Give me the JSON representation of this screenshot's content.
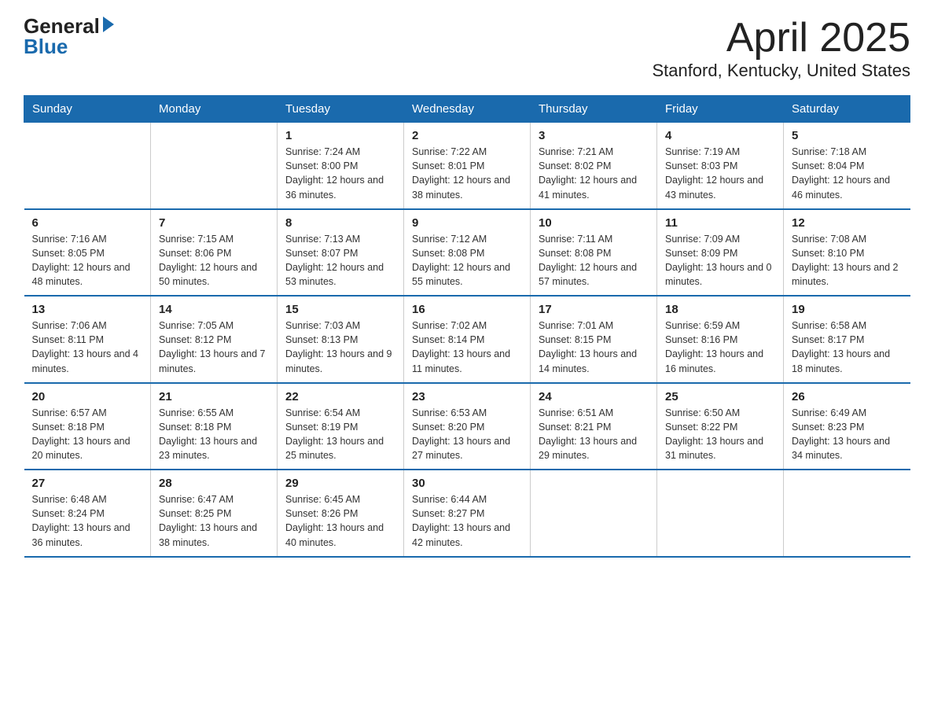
{
  "header": {
    "logo_general": "General",
    "logo_blue": "Blue",
    "title": "April 2025",
    "subtitle": "Stanford, Kentucky, United States"
  },
  "days_of_week": [
    "Sunday",
    "Monday",
    "Tuesday",
    "Wednesday",
    "Thursday",
    "Friday",
    "Saturday"
  ],
  "weeks": [
    [
      {
        "day": "",
        "info": ""
      },
      {
        "day": "",
        "info": ""
      },
      {
        "day": "1",
        "info": "Sunrise: 7:24 AM\nSunset: 8:00 PM\nDaylight: 12 hours\nand 36 minutes."
      },
      {
        "day": "2",
        "info": "Sunrise: 7:22 AM\nSunset: 8:01 PM\nDaylight: 12 hours\nand 38 minutes."
      },
      {
        "day": "3",
        "info": "Sunrise: 7:21 AM\nSunset: 8:02 PM\nDaylight: 12 hours\nand 41 minutes."
      },
      {
        "day": "4",
        "info": "Sunrise: 7:19 AM\nSunset: 8:03 PM\nDaylight: 12 hours\nand 43 minutes."
      },
      {
        "day": "5",
        "info": "Sunrise: 7:18 AM\nSunset: 8:04 PM\nDaylight: 12 hours\nand 46 minutes."
      }
    ],
    [
      {
        "day": "6",
        "info": "Sunrise: 7:16 AM\nSunset: 8:05 PM\nDaylight: 12 hours\nand 48 minutes."
      },
      {
        "day": "7",
        "info": "Sunrise: 7:15 AM\nSunset: 8:06 PM\nDaylight: 12 hours\nand 50 minutes."
      },
      {
        "day": "8",
        "info": "Sunrise: 7:13 AM\nSunset: 8:07 PM\nDaylight: 12 hours\nand 53 minutes."
      },
      {
        "day": "9",
        "info": "Sunrise: 7:12 AM\nSunset: 8:08 PM\nDaylight: 12 hours\nand 55 minutes."
      },
      {
        "day": "10",
        "info": "Sunrise: 7:11 AM\nSunset: 8:08 PM\nDaylight: 12 hours\nand 57 minutes."
      },
      {
        "day": "11",
        "info": "Sunrise: 7:09 AM\nSunset: 8:09 PM\nDaylight: 13 hours\nand 0 minutes."
      },
      {
        "day": "12",
        "info": "Sunrise: 7:08 AM\nSunset: 8:10 PM\nDaylight: 13 hours\nand 2 minutes."
      }
    ],
    [
      {
        "day": "13",
        "info": "Sunrise: 7:06 AM\nSunset: 8:11 PM\nDaylight: 13 hours\nand 4 minutes."
      },
      {
        "day": "14",
        "info": "Sunrise: 7:05 AM\nSunset: 8:12 PM\nDaylight: 13 hours\nand 7 minutes."
      },
      {
        "day": "15",
        "info": "Sunrise: 7:03 AM\nSunset: 8:13 PM\nDaylight: 13 hours\nand 9 minutes."
      },
      {
        "day": "16",
        "info": "Sunrise: 7:02 AM\nSunset: 8:14 PM\nDaylight: 13 hours\nand 11 minutes."
      },
      {
        "day": "17",
        "info": "Sunrise: 7:01 AM\nSunset: 8:15 PM\nDaylight: 13 hours\nand 14 minutes."
      },
      {
        "day": "18",
        "info": "Sunrise: 6:59 AM\nSunset: 8:16 PM\nDaylight: 13 hours\nand 16 minutes."
      },
      {
        "day": "19",
        "info": "Sunrise: 6:58 AM\nSunset: 8:17 PM\nDaylight: 13 hours\nand 18 minutes."
      }
    ],
    [
      {
        "day": "20",
        "info": "Sunrise: 6:57 AM\nSunset: 8:18 PM\nDaylight: 13 hours\nand 20 minutes."
      },
      {
        "day": "21",
        "info": "Sunrise: 6:55 AM\nSunset: 8:18 PM\nDaylight: 13 hours\nand 23 minutes."
      },
      {
        "day": "22",
        "info": "Sunrise: 6:54 AM\nSunset: 8:19 PM\nDaylight: 13 hours\nand 25 minutes."
      },
      {
        "day": "23",
        "info": "Sunrise: 6:53 AM\nSunset: 8:20 PM\nDaylight: 13 hours\nand 27 minutes."
      },
      {
        "day": "24",
        "info": "Sunrise: 6:51 AM\nSunset: 8:21 PM\nDaylight: 13 hours\nand 29 minutes."
      },
      {
        "day": "25",
        "info": "Sunrise: 6:50 AM\nSunset: 8:22 PM\nDaylight: 13 hours\nand 31 minutes."
      },
      {
        "day": "26",
        "info": "Sunrise: 6:49 AM\nSunset: 8:23 PM\nDaylight: 13 hours\nand 34 minutes."
      }
    ],
    [
      {
        "day": "27",
        "info": "Sunrise: 6:48 AM\nSunset: 8:24 PM\nDaylight: 13 hours\nand 36 minutes."
      },
      {
        "day": "28",
        "info": "Sunrise: 6:47 AM\nSunset: 8:25 PM\nDaylight: 13 hours\nand 38 minutes."
      },
      {
        "day": "29",
        "info": "Sunrise: 6:45 AM\nSunset: 8:26 PM\nDaylight: 13 hours\nand 40 minutes."
      },
      {
        "day": "30",
        "info": "Sunrise: 6:44 AM\nSunset: 8:27 PM\nDaylight: 13 hours\nand 42 minutes."
      },
      {
        "day": "",
        "info": ""
      },
      {
        "day": "",
        "info": ""
      },
      {
        "day": "",
        "info": ""
      }
    ]
  ]
}
